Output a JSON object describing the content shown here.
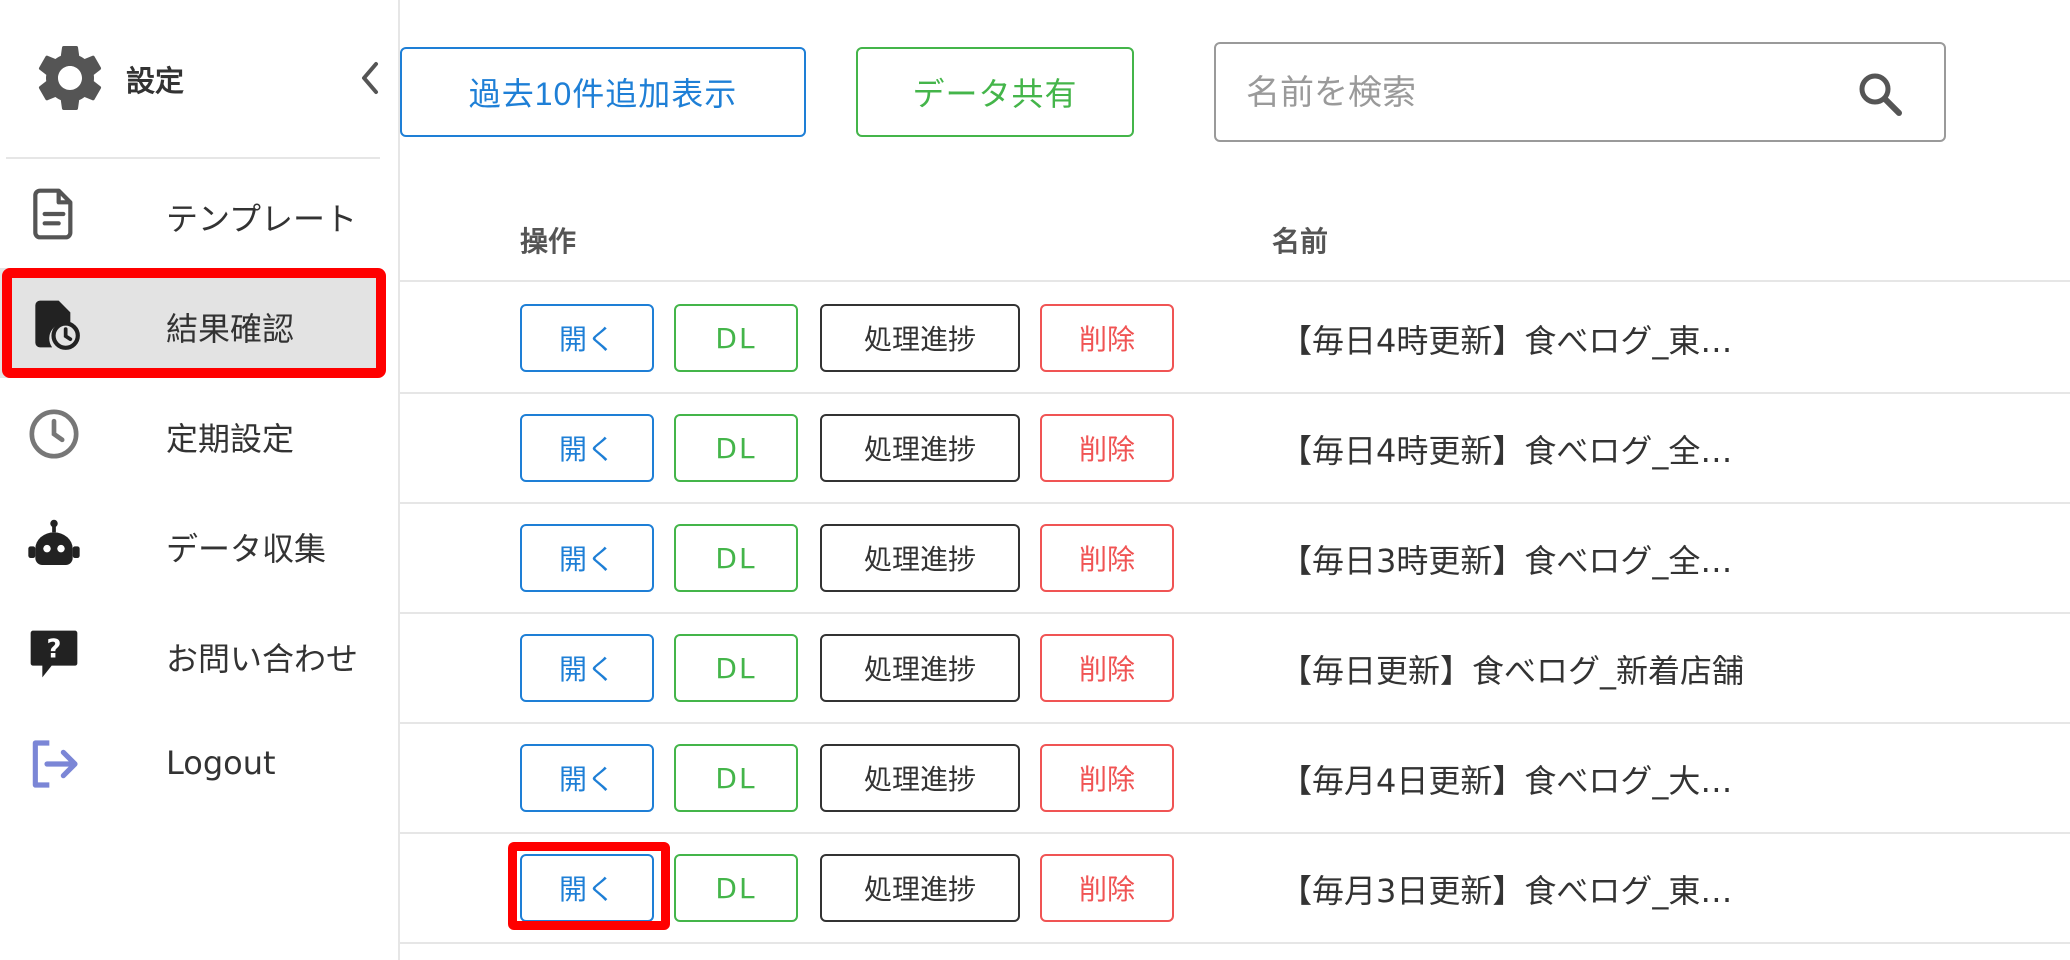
{
  "sidebar": {
    "title": "設定",
    "header_icon": "gear-icon",
    "collapse_icon": "chevron-left-icon",
    "items": [
      {
        "label": "テンプレート",
        "icon": "document-icon"
      },
      {
        "label": "結果確認",
        "icon": "file-clock-icon",
        "active": true
      },
      {
        "label": "定期設定",
        "icon": "clock-icon"
      },
      {
        "label": "データ収集",
        "icon": "robot-icon"
      },
      {
        "label": "お問い合わせ",
        "icon": "help-chat-icon"
      },
      {
        "label": "Logout",
        "icon": "logout-icon"
      }
    ]
  },
  "toolbar": {
    "load_more_label": "過去10件追加表示",
    "share_label": "データ共有",
    "search_placeholder": "名前を検索",
    "search_value": ""
  },
  "table": {
    "headers": {
      "ops": "操作",
      "name": "名前"
    },
    "action_labels": {
      "open": "開く",
      "dl": "DL",
      "progress": "処理進捗",
      "delete": "削除"
    },
    "rows": [
      {
        "name": "【毎日4時更新】食べログ_東…"
      },
      {
        "name": "【毎日4時更新】食べログ_全…"
      },
      {
        "name": "【毎日3時更新】食べログ_全…"
      },
      {
        "name": "【毎日更新】食べログ_新着店舗"
      },
      {
        "name": "【毎月4日更新】食べログ_大…"
      },
      {
        "name": "【毎月3日更新】食べログ_東…"
      }
    ]
  },
  "colors": {
    "primary_blue": "#1e7fd6",
    "success_green": "#44b54a",
    "danger_red": "#f05454",
    "highlight_red": "#ff0000",
    "logout_icon": "#7b86d6"
  }
}
